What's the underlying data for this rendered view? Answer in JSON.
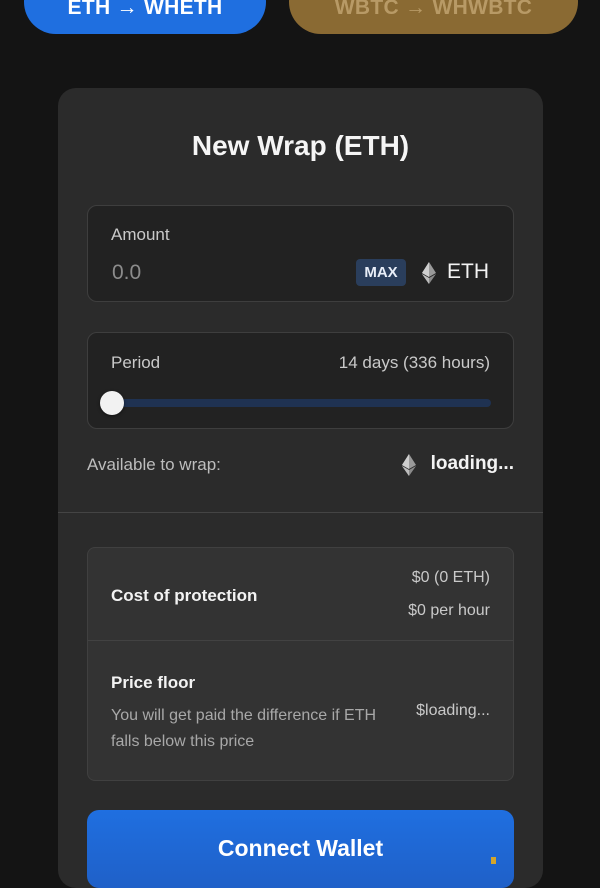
{
  "tabs": [
    {
      "label": "ETH → WHETH",
      "active": true
    },
    {
      "label": "WBTC → WHWBTC",
      "active": false
    }
  ],
  "card": {
    "title": "New Wrap (ETH)"
  },
  "amount": {
    "label": "Amount",
    "placeholder": "0.0",
    "max_label": "MAX",
    "currency": "ETH",
    "currency_icon": "eth-icon"
  },
  "period": {
    "label": "Period",
    "value_text": "14 days (336 hours)",
    "slider_fraction": 0
  },
  "available": {
    "label": "Available to wrap:",
    "value": "loading...",
    "icon": "eth-icon"
  },
  "cost": {
    "label": "Cost of protection",
    "eth_value": "$0 (0 ETH)",
    "per_hour": "$0 per hour"
  },
  "price_floor": {
    "label": "Price floor",
    "description": "You will get paid the difference if ETH falls below this price",
    "value": "$loading..."
  },
  "connect_button": {
    "label": "Connect Wallet"
  },
  "colors": {
    "background": "#141414",
    "card": "#2b2b2b",
    "accent_blue": "#1f6fe0",
    "wbtc_tab": "#8a6a33"
  }
}
